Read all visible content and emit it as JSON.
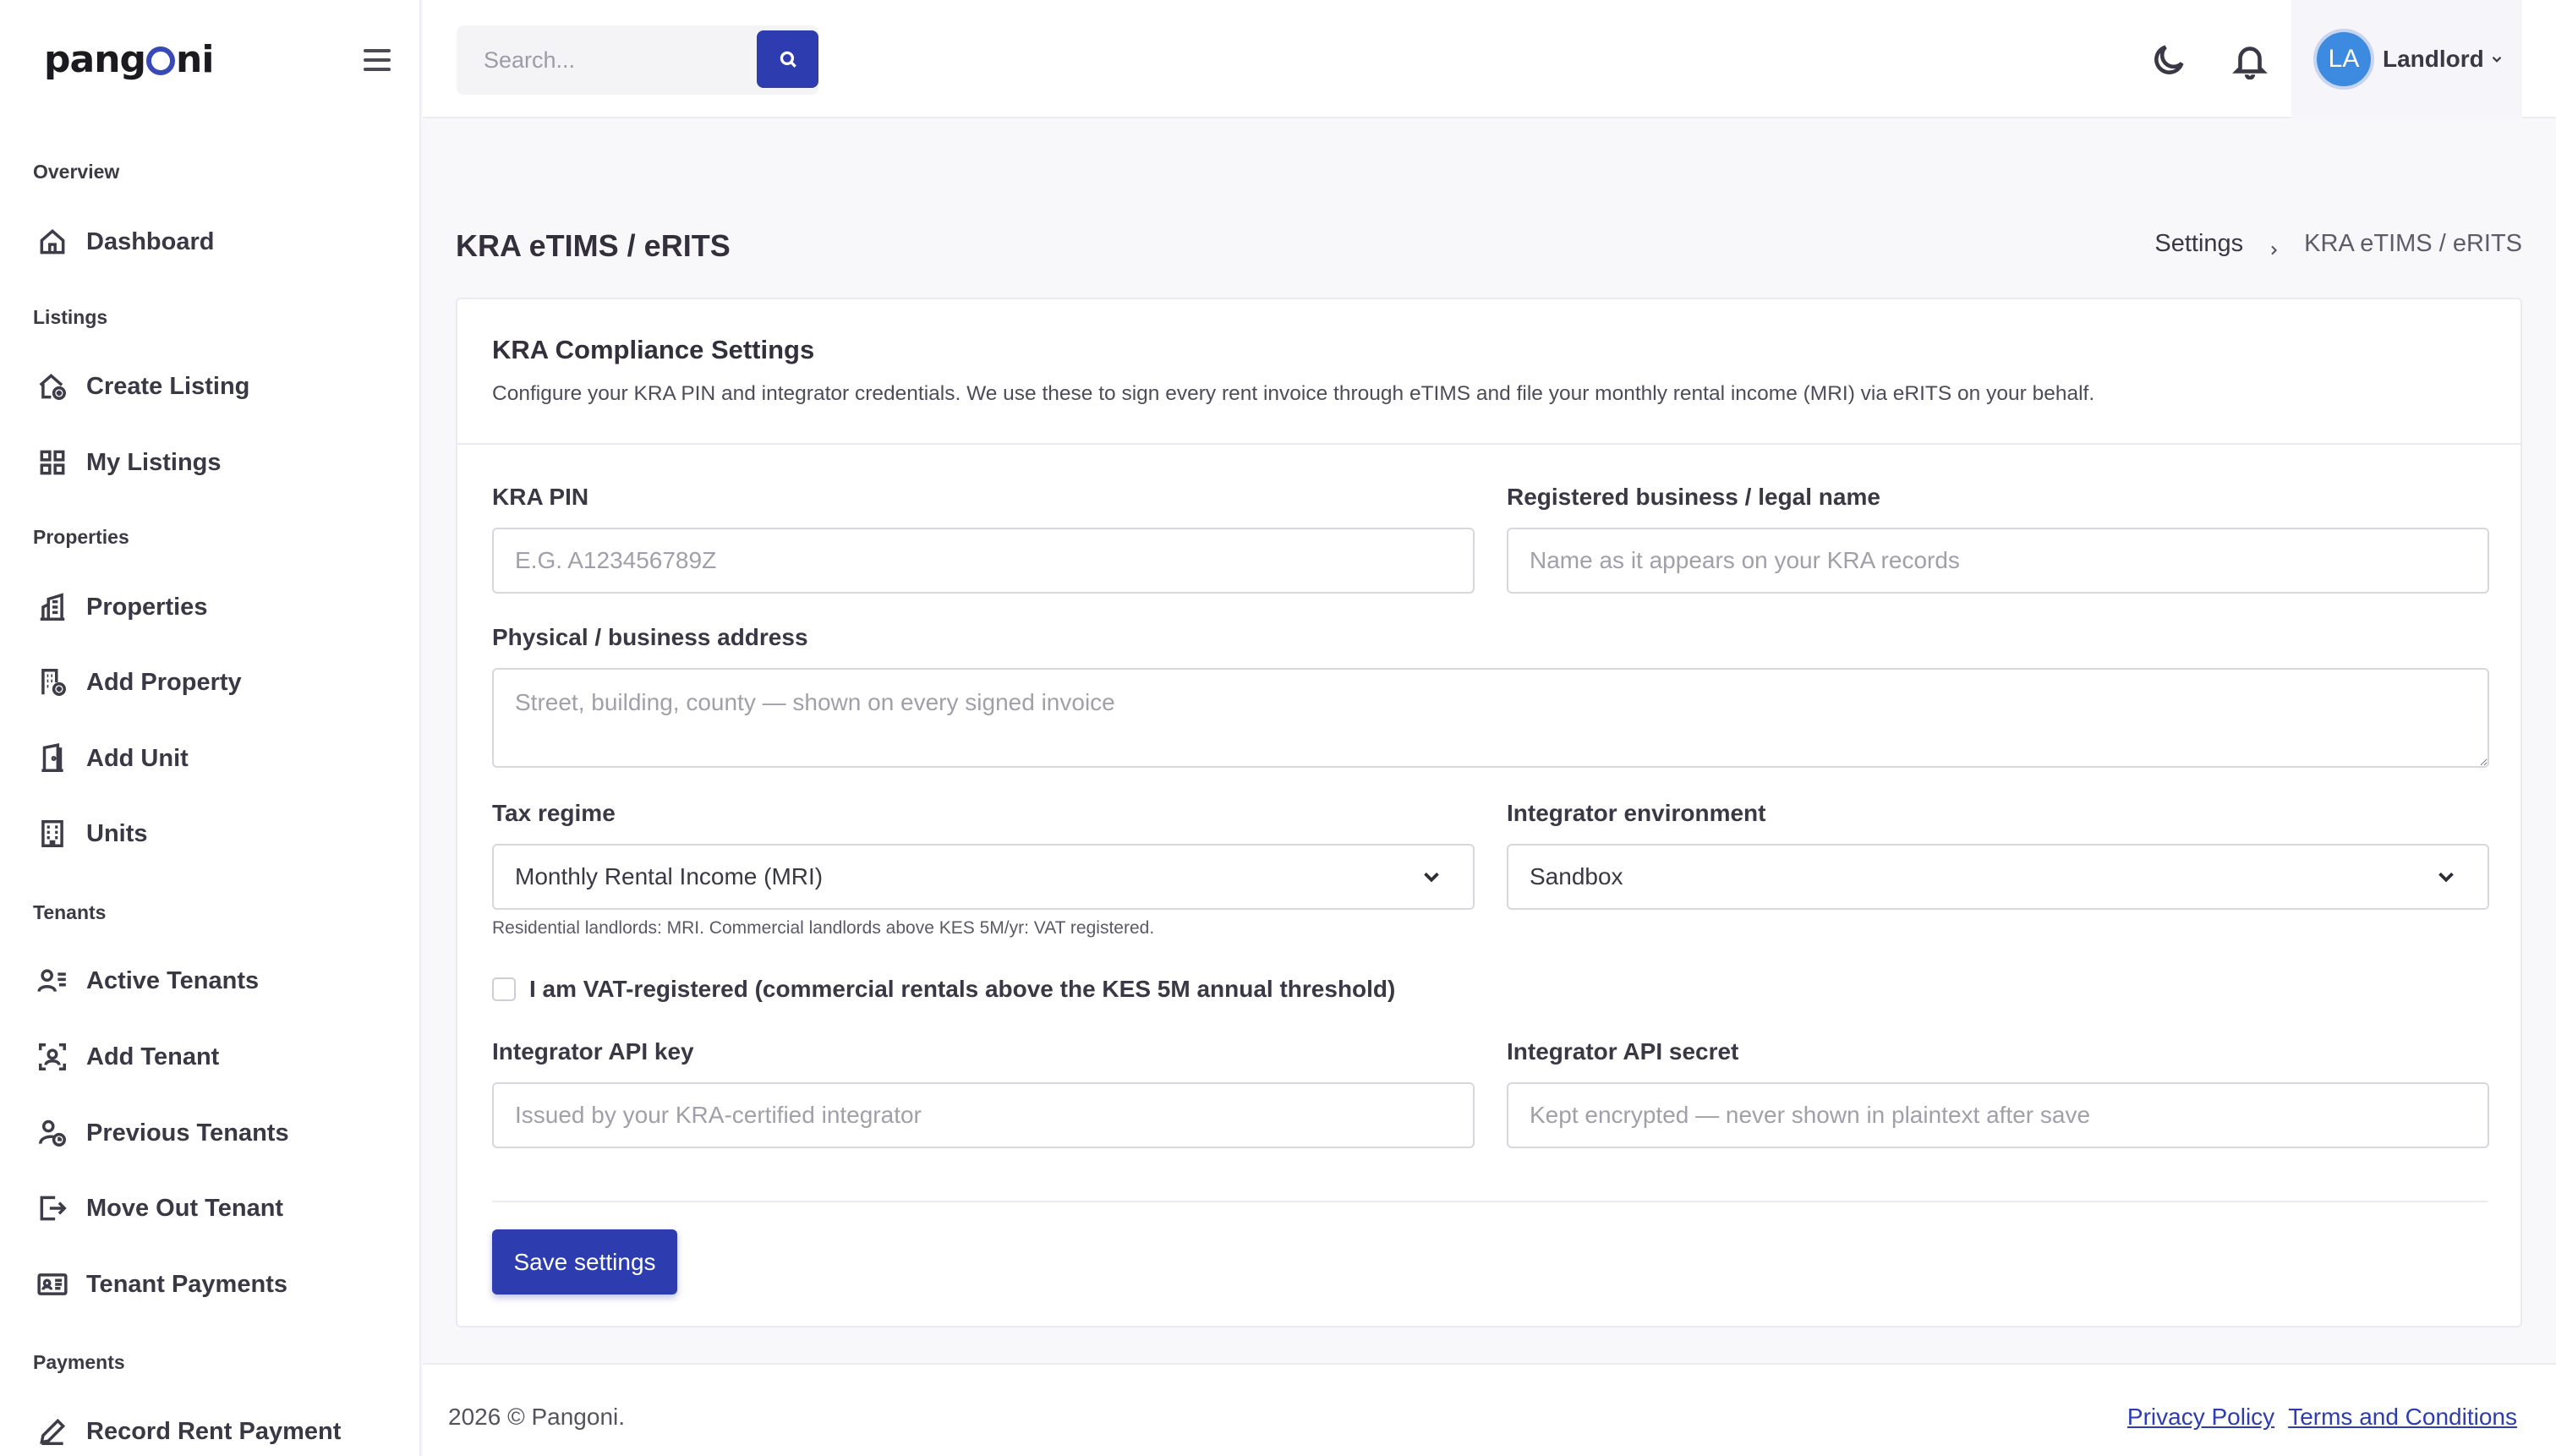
{
  "app": {
    "logo_text": [
      "pang",
      "ni"
    ],
    "logo_name": "pangoni"
  },
  "sidebar": {
    "sections": [
      {
        "title": "Overview",
        "items": [
          {
            "label": "Dashboard",
            "icon": "home-icon"
          }
        ]
      },
      {
        "title": "Listings",
        "items": [
          {
            "label": "Create Listing",
            "icon": "house-add-icon"
          },
          {
            "label": "My Listings",
            "icon": "grid-icon"
          }
        ]
      },
      {
        "title": "Properties",
        "items": [
          {
            "label": "Properties",
            "icon": "buildings-icon"
          },
          {
            "label": "Add Property",
            "icon": "building-add-icon"
          },
          {
            "label": "Add Unit",
            "icon": "door-icon"
          },
          {
            "label": "Units",
            "icon": "building-icon"
          }
        ]
      },
      {
        "title": "Tenants",
        "items": [
          {
            "label": "Active Tenants",
            "icon": "user-list-icon"
          },
          {
            "label": "Add Tenant",
            "icon": "user-frame-icon"
          },
          {
            "label": "Previous Tenants",
            "icon": "user-clock-icon"
          },
          {
            "label": "Move Out Tenant",
            "icon": "exit-icon"
          },
          {
            "label": "Tenant Payments",
            "icon": "id-card-icon"
          }
        ]
      },
      {
        "title": "Payments",
        "items": [
          {
            "label": "Record Rent Payment",
            "icon": "pencil-icon"
          }
        ]
      }
    ]
  },
  "topbar": {
    "search_placeholder": "Search...",
    "user_initials": "LA",
    "user_name": "Landlord"
  },
  "page": {
    "title": "KRA eTIMS / eRITS",
    "breadcrumb": [
      "Settings",
      "KRA eTIMS / eRITS"
    ]
  },
  "card": {
    "title": "KRA Compliance Settings",
    "description": "Configure your KRA PIN and integrator credentials. We use these to sign every rent invoice through eTIMS and file your monthly rental income (MRI) via eRITS on your behalf."
  },
  "form": {
    "kra_pin": {
      "label": "KRA PIN",
      "value": "",
      "placeholder": "E.G. A123456789Z"
    },
    "legal_name": {
      "label": "Registered business / legal name",
      "value": "",
      "placeholder": "Name as it appears on your KRA records"
    },
    "address": {
      "label": "Physical / business address",
      "value": "",
      "placeholder": "Street, building, county — shown on every signed invoice"
    },
    "tax_regime": {
      "label": "Tax regime",
      "selected": "Monthly Rental Income (MRI)",
      "help": "Residential landlords: MRI. Commercial landlords above KES 5M/yr: VAT registered."
    },
    "environment": {
      "label": "Integrator environment",
      "selected": "Sandbox"
    },
    "vat_checkbox": {
      "label": "I am VAT-registered (commercial rentals above the KES 5M annual threshold)",
      "checked": false
    },
    "api_key": {
      "label": "Integrator API key",
      "value": "",
      "placeholder": "Issued by your KRA-certified integrator"
    },
    "api_secret": {
      "label": "Integrator API secret",
      "value": "",
      "placeholder": "Kept encrypted — never shown in plaintext after save"
    },
    "save_label": "Save settings"
  },
  "footer": {
    "copyright": "2026 © Pangoni.",
    "links": [
      "Privacy Policy",
      "Terms and Conditions"
    ]
  },
  "colors": {
    "primary": "#2d3db0",
    "avatar": "#3d8be0",
    "logo_accent": "#3a49b8"
  }
}
